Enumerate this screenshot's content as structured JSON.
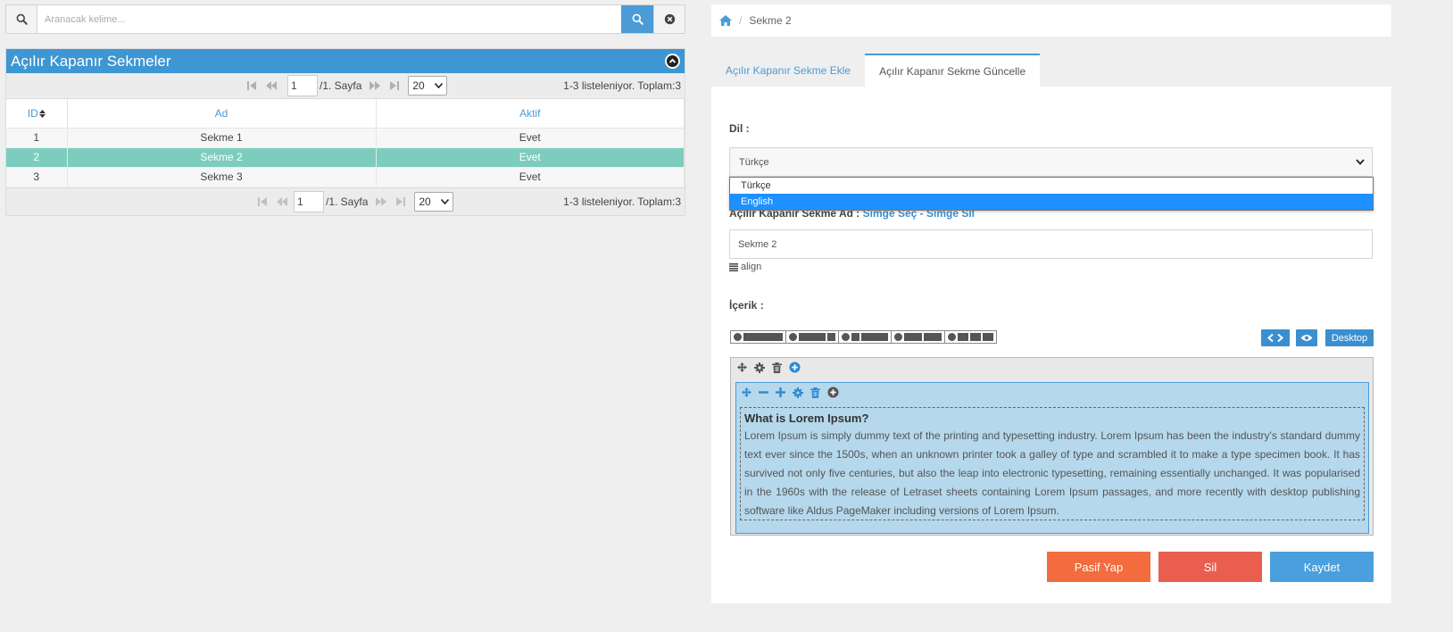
{
  "search": {
    "placeholder": "Aranacak kelime...",
    "search_icon": "magnifier-icon",
    "submit_icon": "search-icon",
    "clear_icon": "close-circle-icon"
  },
  "grid": {
    "title": "Açılır Kapanır Sekmeler",
    "pager": {
      "page": "1",
      "page_of": "/1. Sayfa",
      "page_size": "20",
      "records": "1-3 listeleniyor. Toplam:3"
    },
    "columns": [
      "ID",
      "Ad",
      "Aktif"
    ],
    "rows": [
      {
        "id": "1",
        "name": "Sekme 1",
        "active": "Evet"
      },
      {
        "id": "2",
        "name": "Sekme 2",
        "active": "Evet"
      },
      {
        "id": "3",
        "name": "Sekme 3",
        "active": "Evet"
      }
    ],
    "selected_row": "2"
  },
  "breadcrumb": {
    "current": "Sekme 2"
  },
  "tabs": [
    {
      "label": "Açılır Kapanır Sekme Ekle"
    },
    {
      "label": "Açılır Kapanır Sekme Güncelle"
    }
  ],
  "form": {
    "lang_label": "Dil :",
    "lang_value": "Türkçe",
    "lang_options": [
      "Türkçe",
      "English"
    ],
    "name_label": "Açılır Kapanır Sekme Ad :",
    "icon_select": "Simge Seç",
    "icon_sep": " - ",
    "icon_delete": "Simge Sil",
    "name_value": "Sekme 2",
    "align_label": "align",
    "content_label": "İçerik :",
    "desktop_label": "Desktop",
    "editor_heading": "What is Lorem Ipsum?",
    "editor_body": "Lorem Ipsum is simply dummy text of the printing and typesetting industry. Lorem Ipsum has been the industry's standard dummy text ever since the 1500s, when an unknown printer took a galley of type and scrambled it to make a type specimen book. It has survived not only five centuries, but also the leap into electronic typesetting, remaining essentially unchanged. It was popularised in the 1960s with the release of Letraset sheets containing Lorem Ipsum passages, and more recently with desktop publishing software like Aldus PageMaker including versions of Lorem Ipsum."
  },
  "actions": {
    "passive": "Pasif Yap",
    "delete": "Sil",
    "save": "Kaydet"
  },
  "colors": {
    "accent": "#3e96d3",
    "selected_row": "#7ccdbd",
    "passive_btn": "#f26c3d",
    "delete_btn": "#e95e4f",
    "save_btn": "#4a9fde"
  }
}
